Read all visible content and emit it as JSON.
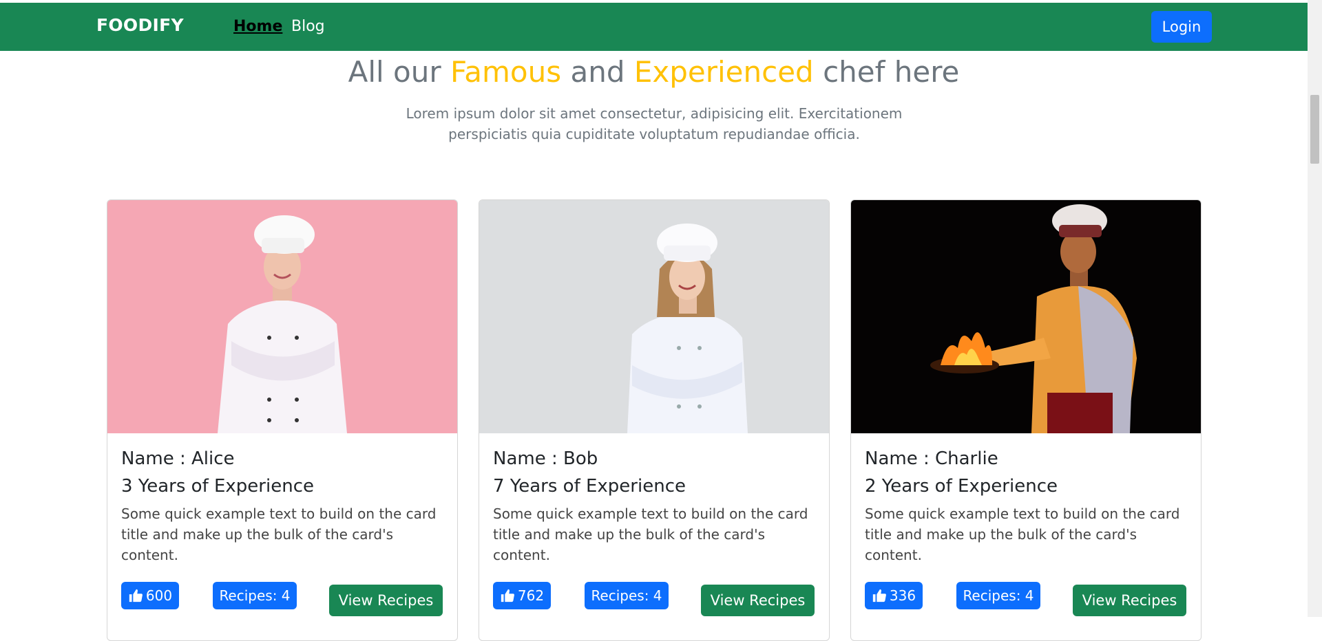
{
  "navbar": {
    "brand": "FOODIFY",
    "links": [
      "Home",
      "Blog"
    ],
    "login_label": "Login"
  },
  "section": {
    "title_parts": [
      "All our ",
      "Famous",
      " and ",
      "Experienced",
      " chef here"
    ],
    "subtitle": "Lorem ipsum dolor sit amet consectetur, adipisicing elit. Exercitationem perspiciatis quia cupiditate voluptatum repudiandae officia."
  },
  "chefs": [
    {
      "name": "Name : Alice",
      "experience": "3 Years of Experience",
      "text": "Some quick example text to build on the card title and make up the bulk of the card's content.",
      "likes": "600",
      "recipes": "Recipes: 4",
      "button": "View Recipes"
    },
    {
      "name": "Name : Bob",
      "experience": "7 Years of Experience",
      "text": "Some quick example text to build on the card title and make up the bulk of the card's content.",
      "likes": "762",
      "recipes": "Recipes: 4",
      "button": "View Recipes"
    },
    {
      "name": "Name : Charlie",
      "experience": "2 Years of Experience",
      "text": "Some quick example text to build on the card title and make up the bulk of the card's content.",
      "likes": "336",
      "recipes": "Recipes: 4",
      "button": "View Recipes"
    }
  ],
  "colors": {
    "navbar": "#198754",
    "primary": "#0d6efd",
    "accent": "#ffc107",
    "muted": "#6c757d"
  },
  "icons": {
    "like": "thumbs-up-icon"
  }
}
